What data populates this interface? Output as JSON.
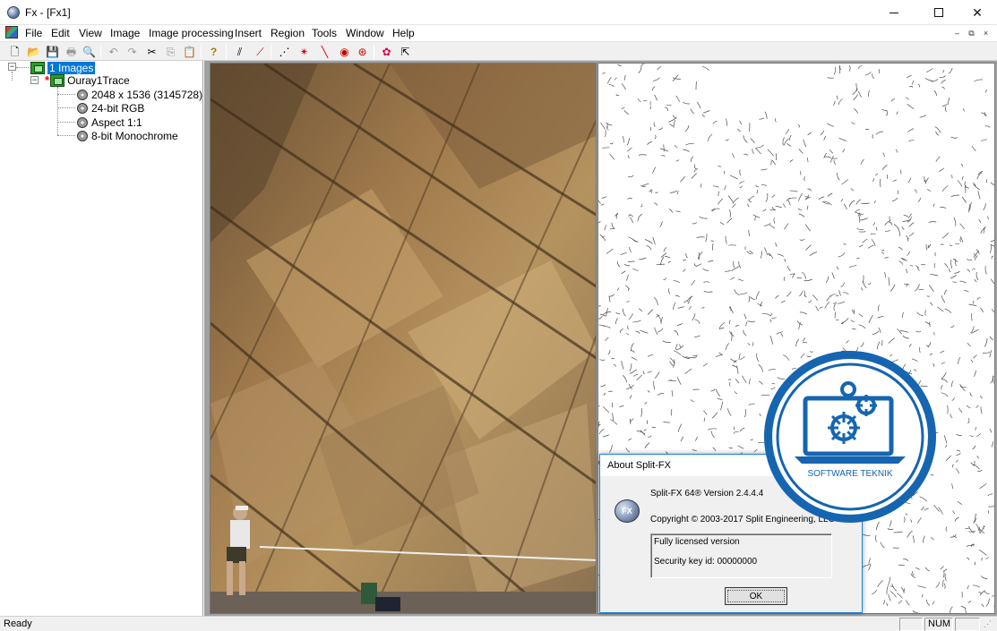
{
  "window": {
    "title": "Fx - [Fx1]",
    "min_symbol": "",
    "max_symbol": "",
    "close_symbol": "✕"
  },
  "menu": {
    "items": [
      "File",
      "Edit",
      "View",
      "Image",
      "Image processing",
      "Insert",
      "Region",
      "Tools",
      "Window",
      "Help"
    ],
    "mdi_min": "–",
    "mdi_restore": "⧉",
    "mdi_close": "×"
  },
  "toolbar": {
    "new_icon": "🗋",
    "open_icon": "📂",
    "save_icon": "💾",
    "print_icon": "🖶",
    "preview_icon": "🔍",
    "undo_icon": "↶",
    "redo_icon": "↷",
    "cut_icon": "✂",
    "copy_icon": "⎘",
    "paste_icon": "📋",
    "help_icon": "?",
    "tool_icons": [
      "⫽",
      "⟋",
      "⋰",
      "✴",
      "╲",
      "◉",
      "⊛",
      "✿",
      "⇱"
    ]
  },
  "tree": {
    "root_label": "1 Images",
    "image_label": "Ouray1Trace",
    "modified_marker": "*",
    "properties": [
      "2048 x 1536  (3145728)",
      "24-bit RGB",
      "Aspect 1:1",
      "8-bit Monochrome"
    ]
  },
  "dialog": {
    "title": "About Split-FX",
    "logo_text": "FX",
    "version_line": "Split-FX 64® Version 2.4.4.4",
    "copyright_line": "Copyright © 2003-2017 Split Engineering, LLC",
    "license_line": "Fully licensed version",
    "security_line": "Security key id: 00000000",
    "ok_label": "OK"
  },
  "badge": {
    "text": "SOFTWARE  TEKNIK",
    "color": "#1565b0"
  },
  "status": {
    "text": "Ready",
    "num": "NUM"
  }
}
